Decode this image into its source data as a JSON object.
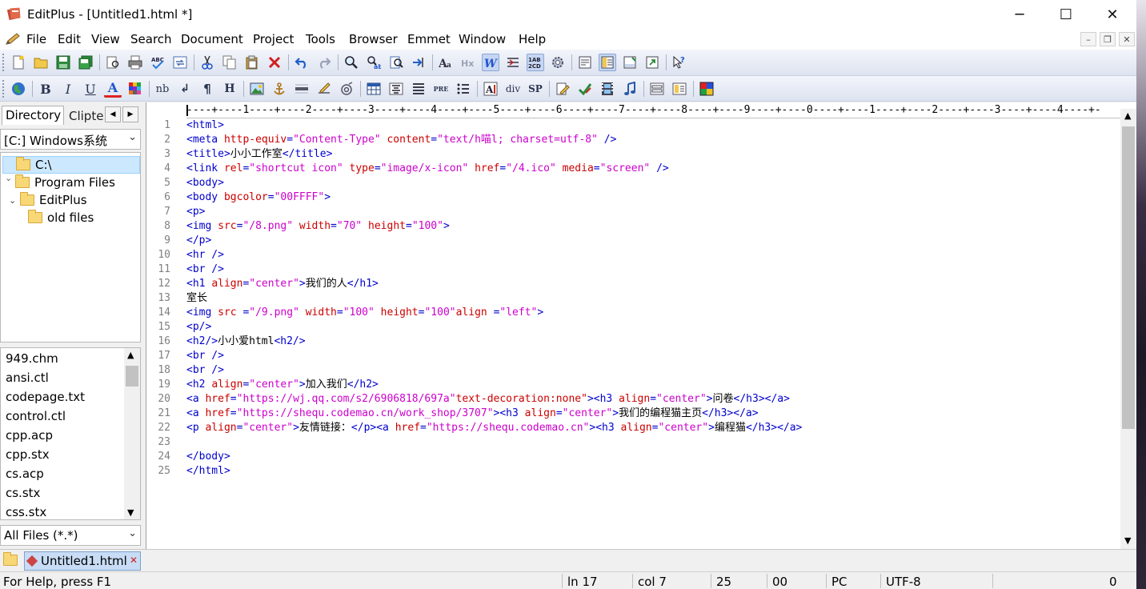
{
  "window": {
    "title": "EditPlus - [Untitled1.html *]",
    "minimize": "─",
    "maximize": "☐",
    "close": "✕"
  },
  "menubar": {
    "items": [
      "File",
      "Edit",
      "View",
      "Search",
      "Document",
      "Project",
      "Tools",
      "Browser",
      "Emmet",
      "Window",
      "Help"
    ],
    "mdi_minimize": "–",
    "mdi_restore": "❐",
    "mdi_close": "✕"
  },
  "toolbar2_labels": {
    "bold": "B",
    "italic": "I",
    "underline": "U",
    "font_color": "A",
    "nbsp": "nb",
    "line_break": "↲",
    "paragraph": "¶",
    "heading": "H",
    "pre": "PRE",
    "div": "div",
    "span": "SP"
  },
  "left_panel": {
    "tab_directory": "Directory",
    "tab_cliptext": "Cliptext",
    "tab_prev": "◀",
    "tab_next": "▶",
    "drive": "[C:] Windows系统",
    "tree": [
      {
        "label": "C:\\",
        "twisty": ""
      },
      {
        "label": "Program Files",
        "twisty": "›"
      },
      {
        "label": "EditPlus",
        "twisty": "⌄"
      },
      {
        "label": "old files",
        "twisty": ""
      }
    ],
    "files": [
      "949.chm",
      "ansi.ctl",
      "codepage.txt",
      "control.ctl",
      "cpp.acp",
      "cpp.stx",
      "cs.acp",
      "cs.stx",
      "css.stx"
    ],
    "filter": "All Files (*.*)"
  },
  "editor": {
    "ruler": "----+----1----+----2----+----3----+----4----+----5----+----6----+----7----+----8----+----9----+----0----+----1----+----2----+----3----+----4----+-",
    "line_numbers": [
      "1",
      "2",
      "3",
      "4",
      "5",
      "6",
      "7",
      "8",
      "9",
      "10",
      "11",
      "12",
      "13",
      "14",
      "15",
      "16",
      "17",
      "18",
      "19",
      "20",
      "21",
      "22",
      "23",
      "24",
      "25"
    ],
    "lines": [
      [
        {
          "t": "tg",
          "v": "<html>"
        }
      ],
      [
        {
          "t": "tg",
          "v": "<meta "
        },
        {
          "t": "at",
          "v": "http-equiv"
        },
        {
          "t": "tg",
          "v": "="
        },
        {
          "t": "av",
          "v": "\"Content-Type\""
        },
        {
          "t": "tx",
          "v": " "
        },
        {
          "t": "at",
          "v": "content"
        },
        {
          "t": "tg",
          "v": "="
        },
        {
          "t": "av",
          "v": "\"text/h喵l; charset=utf-8\""
        },
        {
          "t": "tx",
          "v": " "
        },
        {
          "t": "tg",
          "v": "/>"
        }
      ],
      [
        {
          "t": "tg",
          "v": "<title>"
        },
        {
          "t": "tx",
          "v": "小小工作室"
        },
        {
          "t": "tg",
          "v": "</title>"
        }
      ],
      [
        {
          "t": "tg",
          "v": "<link "
        },
        {
          "t": "at",
          "v": "rel"
        },
        {
          "t": "tg",
          "v": "="
        },
        {
          "t": "av",
          "v": "\"shortcut icon\""
        },
        {
          "t": "tx",
          "v": " "
        },
        {
          "t": "at",
          "v": "type"
        },
        {
          "t": "tg",
          "v": "="
        },
        {
          "t": "av",
          "v": "\"image/x-icon\""
        },
        {
          "t": "tx",
          "v": " "
        },
        {
          "t": "at",
          "v": "href"
        },
        {
          "t": "tg",
          "v": "="
        },
        {
          "t": "av",
          "v": "\"/4.ico\""
        },
        {
          "t": "tx",
          "v": " "
        },
        {
          "t": "at",
          "v": "media"
        },
        {
          "t": "tg",
          "v": "="
        },
        {
          "t": "av",
          "v": "\"screen\""
        },
        {
          "t": "tx",
          "v": " "
        },
        {
          "t": "tg",
          "v": "/>"
        }
      ],
      [
        {
          "t": "tg",
          "v": "<body>"
        }
      ],
      [
        {
          "t": "tg",
          "v": "<body "
        },
        {
          "t": "at",
          "v": "bgcolor"
        },
        {
          "t": "tg",
          "v": "="
        },
        {
          "t": "av",
          "v": "\"00FFFF\""
        },
        {
          "t": "tg",
          "v": ">"
        }
      ],
      [
        {
          "t": "tg",
          "v": "<p>"
        }
      ],
      [
        {
          "t": "tg",
          "v": "<img "
        },
        {
          "t": "at",
          "v": "src"
        },
        {
          "t": "tg",
          "v": "="
        },
        {
          "t": "av",
          "v": "\"/8.png\""
        },
        {
          "t": "tx",
          "v": " "
        },
        {
          "t": "at",
          "v": "width"
        },
        {
          "t": "tg",
          "v": "="
        },
        {
          "t": "av",
          "v": "\"70\""
        },
        {
          "t": "tx",
          "v": " "
        },
        {
          "t": "at",
          "v": "height"
        },
        {
          "t": "tg",
          "v": "="
        },
        {
          "t": "av",
          "v": "\"100\""
        },
        {
          "t": "tg",
          "v": ">"
        }
      ],
      [
        {
          "t": "tg",
          "v": "</p>"
        }
      ],
      [
        {
          "t": "tg",
          "v": "<hr />"
        }
      ],
      [
        {
          "t": "tg",
          "v": "<br />"
        }
      ],
      [
        {
          "t": "tg",
          "v": "<h1 "
        },
        {
          "t": "at",
          "v": "align"
        },
        {
          "t": "tg",
          "v": "="
        },
        {
          "t": "av",
          "v": "\"center\""
        },
        {
          "t": "tg",
          "v": ">"
        },
        {
          "t": "tx",
          "v": "我们的人"
        },
        {
          "t": "tg",
          "v": "</h1>"
        }
      ],
      [
        {
          "t": "tx",
          "v": "室长"
        }
      ],
      [
        {
          "t": "tg",
          "v": "<img "
        },
        {
          "t": "at",
          "v": "src "
        },
        {
          "t": "tg",
          "v": "="
        },
        {
          "t": "av",
          "v": "\"/9.png\""
        },
        {
          "t": "tx",
          "v": " "
        },
        {
          "t": "at",
          "v": "width"
        },
        {
          "t": "tg",
          "v": "="
        },
        {
          "t": "av",
          "v": "\"100\""
        },
        {
          "t": "tx",
          "v": " "
        },
        {
          "t": "at",
          "v": "height"
        },
        {
          "t": "tg",
          "v": "="
        },
        {
          "t": "av",
          "v": "\"100\""
        },
        {
          "t": "at",
          "v": "align "
        },
        {
          "t": "tg",
          "v": "="
        },
        {
          "t": "av",
          "v": "\"left\""
        },
        {
          "t": "tg",
          "v": ">"
        }
      ],
      [
        {
          "t": "tg",
          "v": "<p/>"
        }
      ],
      [
        {
          "t": "tg",
          "v": "<h2/>"
        },
        {
          "t": "tx",
          "v": "小小爱html"
        },
        {
          "t": "tg",
          "v": "<h2/>"
        }
      ],
      [
        {
          "t": "tg",
          "v": "<br />"
        }
      ],
      [
        {
          "t": "tg",
          "v": "<br />"
        }
      ],
      [
        {
          "t": "tg",
          "v": "<h2 "
        },
        {
          "t": "at",
          "v": "align"
        },
        {
          "t": "tg",
          "v": "="
        },
        {
          "t": "av",
          "v": "\"center\""
        },
        {
          "t": "tg",
          "v": ">"
        },
        {
          "t": "tx",
          "v": "加入我们"
        },
        {
          "t": "tg",
          "v": "</h2>"
        }
      ],
      [
        {
          "t": "tg",
          "v": "<a "
        },
        {
          "t": "at",
          "v": "href"
        },
        {
          "t": "tg",
          "v": "="
        },
        {
          "t": "av",
          "v": "\"https://wj.qq.com/s2/6906818/697a\""
        },
        {
          "t": "at",
          "v": "text-decoration:none\""
        },
        {
          "t": "tg",
          "v": ">"
        },
        {
          "t": "tg",
          "v": "<h3 "
        },
        {
          "t": "at",
          "v": "align"
        },
        {
          "t": "tg",
          "v": "="
        },
        {
          "t": "av",
          "v": "\"center\""
        },
        {
          "t": "tg",
          "v": ">"
        },
        {
          "t": "tx",
          "v": "问卷"
        },
        {
          "t": "tg",
          "v": "</h3></a>"
        }
      ],
      [
        {
          "t": "tg",
          "v": "<a "
        },
        {
          "t": "at",
          "v": "href"
        },
        {
          "t": "tg",
          "v": "="
        },
        {
          "t": "av",
          "v": "\"https://shequ.codemao.cn/work_shop/3707\""
        },
        {
          "t": "tg",
          "v": ">"
        },
        {
          "t": "tg",
          "v": "<h3 "
        },
        {
          "t": "at",
          "v": "align"
        },
        {
          "t": "tg",
          "v": "="
        },
        {
          "t": "av",
          "v": "\"center\""
        },
        {
          "t": "tg",
          "v": ">"
        },
        {
          "t": "tx",
          "v": "我们的编程猫主页"
        },
        {
          "t": "tg",
          "v": "</h3></a>"
        }
      ],
      [
        {
          "t": "tg",
          "v": "<p "
        },
        {
          "t": "at",
          "v": "align"
        },
        {
          "t": "tg",
          "v": "="
        },
        {
          "t": "av",
          "v": "\"center\""
        },
        {
          "t": "tg",
          "v": ">"
        },
        {
          "t": "tx",
          "v": "友情链接："
        },
        {
          "t": "tg",
          "v": "</p>"
        },
        {
          "t": "tg",
          "v": "<a "
        },
        {
          "t": "at",
          "v": "href"
        },
        {
          "t": "tg",
          "v": "="
        },
        {
          "t": "av",
          "v": "\"https://shequ.codemao.cn\""
        },
        {
          "t": "tg",
          "v": ">"
        },
        {
          "t": "tg",
          "v": "<h3 "
        },
        {
          "t": "at",
          "v": "align"
        },
        {
          "t": "tg",
          "v": "="
        },
        {
          "t": "av",
          "v": "\"center\""
        },
        {
          "t": "tg",
          "v": ">"
        },
        {
          "t": "tx",
          "v": "编程猫"
        },
        {
          "t": "tg",
          "v": "</h3></a>"
        }
      ],
      [],
      [
        {
          "t": "tg",
          "v": "</body>"
        }
      ],
      [
        {
          "t": "tg",
          "v": "</html>"
        }
      ]
    ]
  },
  "doc_tabs": {
    "active": "Untitled1.html",
    "close": "✕"
  },
  "statusbar": {
    "help": "For Help, press F1",
    "ln": "ln 17",
    "col": "col 7",
    "v25": "25",
    "v00": "00",
    "mode": "PC",
    "encoding": "UTF-8",
    "last": "0"
  },
  "colors": {
    "tag": "#0000cc",
    "attribute": "#cc0000",
    "value": "#cc00cc",
    "text": "#000000",
    "line_number": "#808080"
  }
}
